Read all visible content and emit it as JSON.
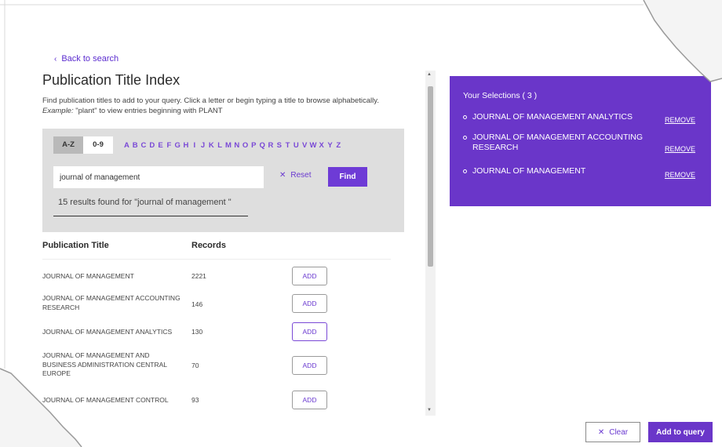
{
  "back_link": {
    "label": "Back to search"
  },
  "page": {
    "title": "Publication Title Index",
    "description": "Find publication titles to add to your query. Click a letter or begin typing a title to browse alphabetically.",
    "example_label": "Example:",
    "example_text": " \"plant\" to view entries beginning with PLANT"
  },
  "alphabet": {
    "tabs": [
      "A-Z",
      "0-9"
    ],
    "active_tab": "A-Z",
    "letters": [
      "A",
      "B",
      "C",
      "D",
      "E",
      "F",
      "G",
      "H",
      "I",
      "J",
      "K",
      "L",
      "M",
      "N",
      "O",
      "P",
      "Q",
      "R",
      "S",
      "T",
      "U",
      "V",
      "W",
      "X",
      "Y",
      "Z"
    ]
  },
  "search": {
    "value": "journal of management",
    "reset_label": "Reset",
    "find_label": "Find",
    "results_text": "15 results found for \"journal of management \""
  },
  "table": {
    "headers": {
      "title": "Publication Title",
      "records": "Records"
    },
    "add_label": "ADD",
    "rows": [
      {
        "title": "JOURNAL OF MANAGEMENT",
        "records": "2221"
      },
      {
        "title": "JOURNAL OF MANAGEMENT ACCOUNTING RESEARCH",
        "records": "146"
      },
      {
        "title": "JOURNAL OF MANAGEMENT ANALYTICS",
        "records": "130"
      },
      {
        "title": "JOURNAL OF MANAGEMENT AND BUSINESS ADMINISTRATION CENTRAL EUROPE",
        "records": "70"
      },
      {
        "title": "JOURNAL OF MANAGEMENT CONTROL",
        "records": "93"
      }
    ]
  },
  "selections": {
    "title": "Your Selections ( 3 )",
    "remove_label": "REMOVE",
    "items": [
      "JOURNAL OF MANAGEMENT ANALYTICS",
      "JOURNAL OF MANAGEMENT ACCOUNTING RESEARCH",
      "JOURNAL OF MANAGEMENT"
    ]
  },
  "footer": {
    "clear_label": "Clear",
    "add_to_query_label": "Add to query"
  },
  "colors": {
    "accent": "#6a36c9",
    "panel_gray": "#dedede"
  }
}
